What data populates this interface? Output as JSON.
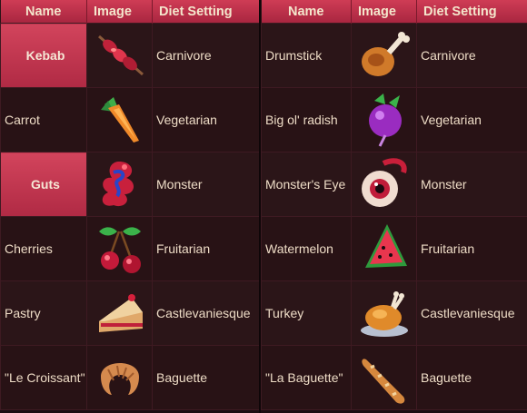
{
  "left_table": {
    "headers": [
      "Name",
      "Image",
      "Diet Setting"
    ],
    "rows": [
      {
        "name": "Kebab",
        "icon": "kebab-icon",
        "diet": "Carnivore"
      },
      {
        "name": "Carrot",
        "icon": "carrot-icon",
        "diet": "Vegetarian"
      },
      {
        "name": "Guts",
        "icon": "guts-icon",
        "diet": "Monster"
      },
      {
        "name": "Cherries",
        "icon": "cherries-icon",
        "diet": "Fruitarian"
      },
      {
        "name": "Pastry",
        "icon": "pastry-icon",
        "diet": "Castlevaniesque"
      },
      {
        "name": "\"Le Croissant\"",
        "icon": "croissant-icon",
        "diet": "Baguette"
      }
    ]
  },
  "right_table": {
    "headers": [
      "Name",
      "Image",
      "Diet Setting"
    ],
    "rows": [
      {
        "name": "Drumstick",
        "icon": "drumstick-icon",
        "diet": "Carnivore"
      },
      {
        "name": "Big ol' radish",
        "icon": "radish-icon",
        "diet": "Vegetarian"
      },
      {
        "name": "Monster's Eye",
        "icon": "eyeball-icon",
        "diet": "Monster"
      },
      {
        "name": "Watermelon",
        "icon": "watermelon-icon",
        "diet": "Fruitarian"
      },
      {
        "name": "Turkey",
        "icon": "turkey-icon",
        "diet": "Castlevaniesque"
      },
      {
        "name": "\"La Baguette\"",
        "icon": "baguette-icon",
        "diet": "Baguette"
      }
    ]
  },
  "colors": {
    "header_red": "#c2334d",
    "highlight_red": "#c53a52",
    "row_bg": "#2a1417",
    "text": "#eedcc6"
  }
}
